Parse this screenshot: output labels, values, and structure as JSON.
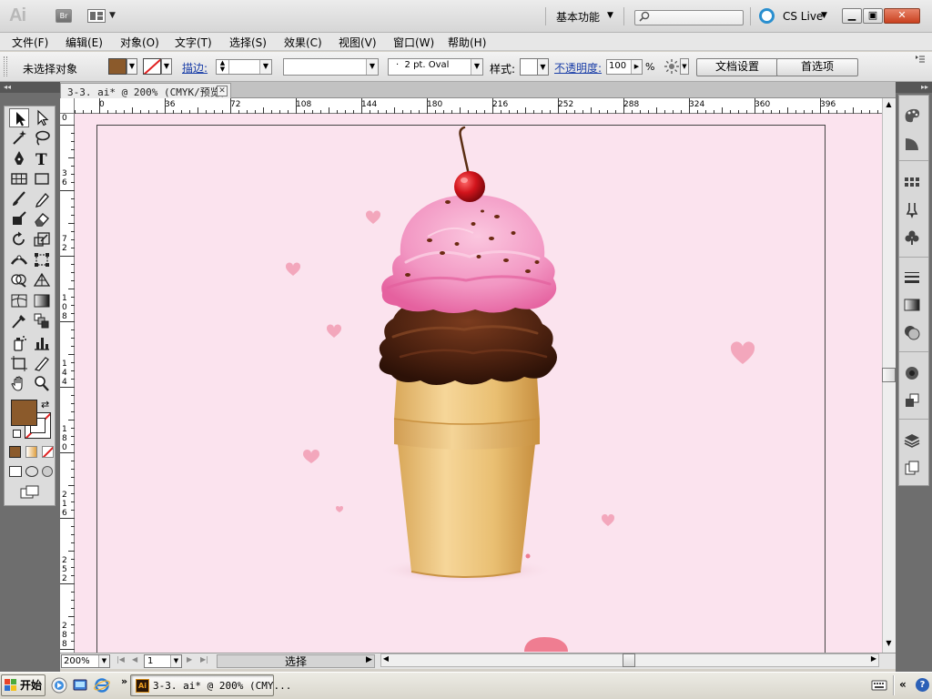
{
  "app": {
    "logo": "Ai",
    "bridge_label": "Br",
    "workspace": "基本功能",
    "search_placeholder": "",
    "cslive": "CS Live"
  },
  "menu": [
    {
      "label": "文件(F)"
    },
    {
      "label": "编辑(E)"
    },
    {
      "label": "对象(O)"
    },
    {
      "label": "文字(T)"
    },
    {
      "label": "选择(S)"
    },
    {
      "label": "效果(C)"
    },
    {
      "label": "视图(V)"
    },
    {
      "label": "窗口(W)"
    },
    {
      "label": "帮助(H)"
    }
  ],
  "control": {
    "no_selection": "未选择对象",
    "fill_color": "#8b5a2b",
    "stroke_label": "描边:",
    "stroke_weight": "",
    "brush": "2 pt. Oval",
    "style_label": "样式:",
    "opacity_label": "不透明度:",
    "opacity_value": "100",
    "opacity_unit": "%",
    "doc_setup": "文档设置",
    "prefs": "首选项"
  },
  "document": {
    "tab_label": "3-3. ai* @ 200% (CMYK/预览)",
    "ruler_h": [
      "0",
      "36",
      "72",
      "108",
      "144",
      "180",
      "216",
      "252",
      "288",
      "324",
      "360",
      "396"
    ],
    "ruler_v": [
      "0",
      "3 6",
      "7 2",
      "1 0 8",
      "1 4 4",
      "1 8 0",
      "2 1 6",
      "2 5 2",
      "2 8 8"
    ],
    "canvas_color": "#fbe3ee"
  },
  "status": {
    "zoom": "200%",
    "artboard": "1",
    "tool_status": "选择"
  },
  "taskbar": {
    "start": "开始",
    "task_label": "3-3. ai* @ 200% (CMY...",
    "task_icon": "Ai",
    "more": "»",
    "tray_arrows": "«",
    "help": "?"
  },
  "colors": {
    "fill": "#8b5a2b",
    "accent_link": "#1a3ea8",
    "strawberry": "#f39ac4",
    "chocolate": "#4a2412",
    "cone": "#e8c07a",
    "cherry": "#c3131c",
    "heart": "#f3a3b8"
  }
}
